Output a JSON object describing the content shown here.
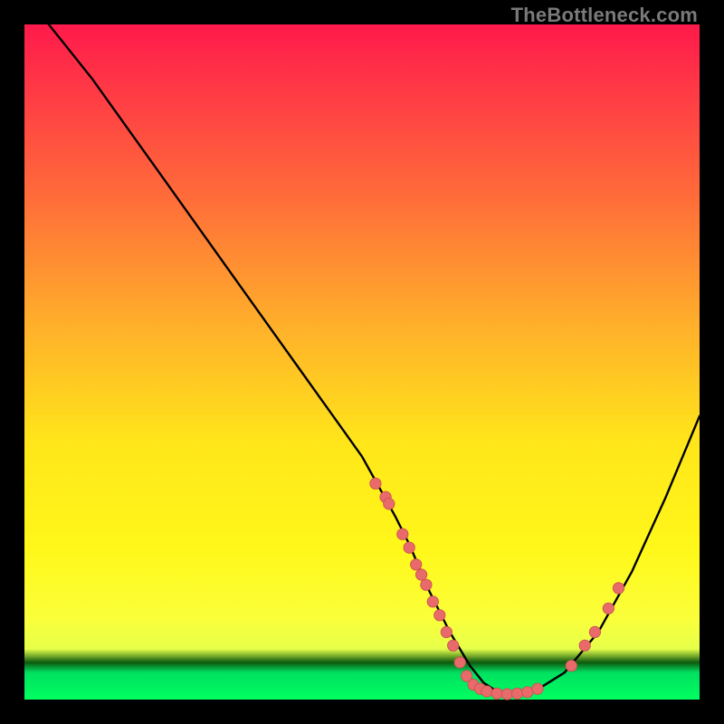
{
  "watermark": "TheBottleneck.com",
  "colors": {
    "page_bg": "#000000",
    "curve_stroke": "#000000",
    "dot_fill": "#e86a6a",
    "dot_stroke": "#c94f4f"
  },
  "chart_data": {
    "type": "line",
    "title": "",
    "xlabel": "",
    "ylabel": "",
    "xlim": [
      0,
      100
    ],
    "ylim": [
      0,
      100
    ],
    "note": "Axes are normalized 0-100. y is inverted visually (0 at bottom). Values are estimated from pixels; the image has no tick labels.",
    "series": [
      {
        "name": "bottleneck-curve",
        "x": [
          0,
          2,
          6,
          10,
          15,
          20,
          25,
          30,
          35,
          40,
          45,
          50,
          55,
          57,
          60,
          63,
          66,
          68,
          70,
          72,
          76,
          80,
          85,
          90,
          95,
          100
        ],
        "y": [
          105,
          102,
          97,
          92,
          85,
          78,
          71,
          64,
          57,
          50,
          43,
          36,
          27,
          23,
          16,
          10,
          5,
          2.5,
          1.2,
          0.8,
          1.5,
          4,
          10,
          19,
          30,
          42
        ]
      }
    ],
    "scatter": [
      {
        "name": "sample-dots",
        "points": [
          [
            52,
            32
          ],
          [
            53.5,
            30
          ],
          [
            54,
            29
          ],
          [
            56,
            24.5
          ],
          [
            57,
            22.5
          ],
          [
            58,
            20
          ],
          [
            58.8,
            18.5
          ],
          [
            59.5,
            17
          ],
          [
            60.5,
            14.5
          ],
          [
            61.5,
            12.5
          ],
          [
            62.5,
            10
          ],
          [
            63.5,
            8
          ],
          [
            64.5,
            5.5
          ],
          [
            65.5,
            3.5
          ],
          [
            66.5,
            2.2
          ],
          [
            67.5,
            1.6
          ],
          [
            68.5,
            1.2
          ],
          [
            70,
            0.9
          ],
          [
            71.5,
            0.8
          ],
          [
            73,
            0.9
          ],
          [
            74.5,
            1.1
          ],
          [
            76,
            1.6
          ],
          [
            81,
            5
          ],
          [
            83,
            8
          ],
          [
            84.5,
            10
          ],
          [
            86.5,
            13.5
          ],
          [
            88,
            16.5
          ]
        ]
      }
    ]
  }
}
